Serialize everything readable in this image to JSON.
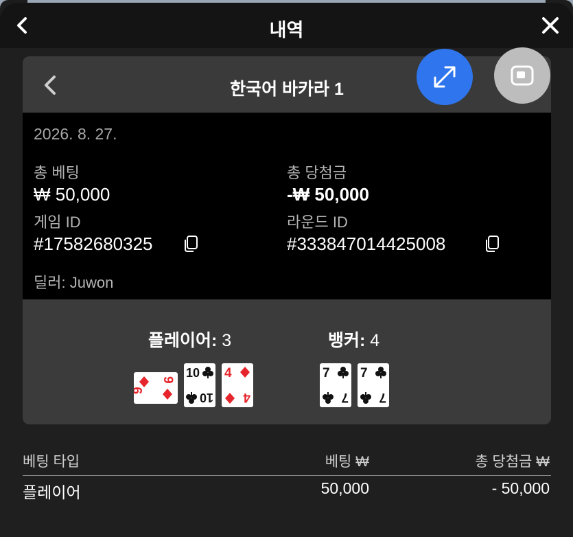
{
  "header": {
    "title": "내역"
  },
  "game_card": {
    "title": "한국어 바카라 1",
    "date": "2026. 8. 27.",
    "total_bet_label": "총 베팅",
    "total_bet_value": "₩ 50,000",
    "total_win_label": "총 당첨금",
    "total_win_value": "-₩ 50,000",
    "game_id_label": "게임 ID",
    "game_id_value": "#17582680325",
    "round_id_label": "라운드 ID",
    "round_id_value": "#333847014425008",
    "dealer": "딜러: Juwon"
  },
  "result": {
    "player_label": "플레이어:",
    "player_score": "3",
    "banker_label": "뱅커:",
    "banker_score": "4",
    "player_cards": [
      {
        "rank": "9",
        "suit": "diamonds",
        "orientation": "sideways"
      },
      {
        "rank": "10",
        "suit": "clubs",
        "orientation": "upright"
      },
      {
        "rank": "4",
        "suit": "diamonds",
        "orientation": "upright"
      }
    ],
    "banker_cards": [
      {
        "rank": "7",
        "suit": "clubs",
        "orientation": "upright"
      },
      {
        "rank": "7",
        "suit": "clubs",
        "orientation": "upright"
      }
    ]
  },
  "bet_table": {
    "headers": [
      "베팅 타입",
      "베팅 ₩",
      "총 당첨금 ₩"
    ],
    "rows": [
      [
        "플레이어",
        "50,000",
        "- 50,000"
      ]
    ]
  },
  "icons": {
    "back": "chevron-left-icon",
    "close": "close-icon",
    "copy": "copy-icon",
    "expand": "expand-arrows-icon",
    "minimize": "minimize-window-icon"
  },
  "colors": {
    "accent_blue": "#2f76ee",
    "card_red": "#e5252b"
  }
}
